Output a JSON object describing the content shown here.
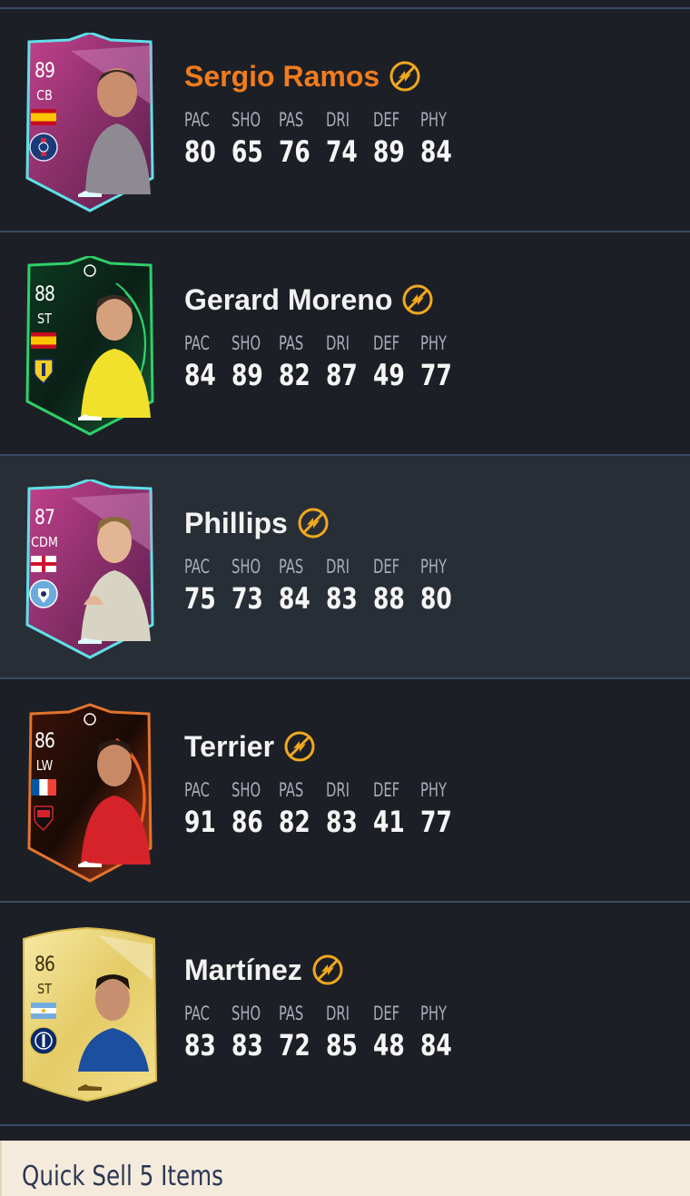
{
  "players": [
    {
      "name": "Sergio Ramos",
      "highlight": true,
      "rating": "89",
      "position": "CB",
      "nation_flag": "spain-flag-icon",
      "club_badge": "psg-badge-icon",
      "card_style": "pink-special",
      "untradeable_icon": "untradeable-icon",
      "stats": [
        {
          "label": "PAC",
          "value": "80"
        },
        {
          "label": "SHO",
          "value": "65"
        },
        {
          "label": "PAS",
          "value": "76"
        },
        {
          "label": "DRI",
          "value": "74"
        },
        {
          "label": "DEF",
          "value": "89"
        },
        {
          "label": "PHY",
          "value": "84"
        }
      ]
    },
    {
      "name": "Gerard Moreno",
      "highlight": false,
      "rating": "88",
      "position": "ST",
      "nation_flag": "spain-flag-icon",
      "club_badge": "villarreal-badge-icon",
      "card_style": "green-special",
      "untradeable_icon": "untradeable-icon",
      "stats": [
        {
          "label": "PAC",
          "value": "84"
        },
        {
          "label": "SHO",
          "value": "89"
        },
        {
          "label": "PAS",
          "value": "82"
        },
        {
          "label": "DRI",
          "value": "87"
        },
        {
          "label": "DEF",
          "value": "49"
        },
        {
          "label": "PHY",
          "value": "77"
        }
      ]
    },
    {
      "name": "Phillips",
      "highlight": false,
      "rating": "87",
      "position": "CDM",
      "nation_flag": "england-flag-icon",
      "club_badge": "man-city-badge-icon",
      "card_style": "pink-special",
      "untradeable_icon": "untradeable-icon",
      "stats": [
        {
          "label": "PAC",
          "value": "75"
        },
        {
          "label": "SHO",
          "value": "73"
        },
        {
          "label": "PAS",
          "value": "84"
        },
        {
          "label": "DRI",
          "value": "83"
        },
        {
          "label": "DEF",
          "value": "88"
        },
        {
          "label": "PHY",
          "value": "80"
        }
      ]
    },
    {
      "name": "Terrier",
      "highlight": false,
      "rating": "86",
      "position": "LW",
      "nation_flag": "france-flag-icon",
      "club_badge": "rennes-badge-icon",
      "card_style": "orange-special",
      "untradeable_icon": "untradeable-icon",
      "stats": [
        {
          "label": "PAC",
          "value": "91"
        },
        {
          "label": "SHO",
          "value": "86"
        },
        {
          "label": "PAS",
          "value": "82"
        },
        {
          "label": "DRI",
          "value": "83"
        },
        {
          "label": "DEF",
          "value": "41"
        },
        {
          "label": "PHY",
          "value": "77"
        }
      ]
    },
    {
      "name": "Martínez",
      "highlight": false,
      "rating": "86",
      "position": "ST",
      "nation_flag": "argentina-flag-icon",
      "club_badge": "inter-badge-icon",
      "card_style": "gold",
      "untradeable_icon": "untradeable-icon",
      "stats": [
        {
          "label": "PAC",
          "value": "83"
        },
        {
          "label": "SHO",
          "value": "83"
        },
        {
          "label": "PAS",
          "value": "72"
        },
        {
          "label": "DRI",
          "value": "85"
        },
        {
          "label": "DEF",
          "value": "48"
        },
        {
          "label": "PHY",
          "value": "84"
        }
      ]
    }
  ],
  "selected_index": 2,
  "footer": {
    "quick_sell_label": "Quick Sell 5 Items"
  },
  "colors": {
    "background": "#1d1f26",
    "selected_row": "#282e36",
    "divider": "#3a4a63",
    "highlight_name": "#f07c1e",
    "untradeable": "#f0a81e",
    "footer_bg": "#f5ebdc",
    "footer_text": "#2a3654"
  }
}
